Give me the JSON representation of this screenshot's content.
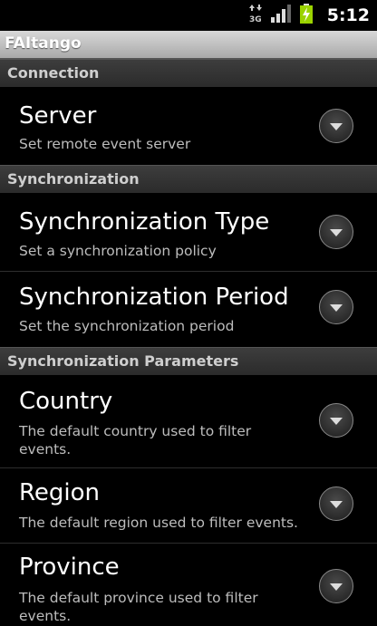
{
  "status_bar": {
    "time": "5:12",
    "icons": [
      "data-arrows-3g-icon",
      "signal-bars-icon",
      "battery-charging-icon"
    ],
    "network_label": "3G"
  },
  "app": {
    "title": "FAItango"
  },
  "sections": {
    "connection": {
      "header": "Connection",
      "server": {
        "title": "Server",
        "summary": "Set remote event server"
      }
    },
    "synchronization": {
      "header": "Synchronization",
      "type": {
        "title": "Synchronization Type",
        "summary": "Set a synchronization policy"
      },
      "period": {
        "title": "Synchronization Period",
        "summary": "Set the synchronization period"
      }
    },
    "parameters": {
      "header": "Synchronization Parameters",
      "country": {
        "title": "Country",
        "summary": "The default country used to filter events."
      },
      "region": {
        "title": "Region",
        "summary": "The default region used to filter events."
      },
      "province": {
        "title": "Province",
        "summary": "The default province used to filter events."
      }
    }
  },
  "colors": {
    "category_bg": "#333333",
    "title_bar": "#bdbdbd",
    "summary_text": "#bdbdbd"
  }
}
